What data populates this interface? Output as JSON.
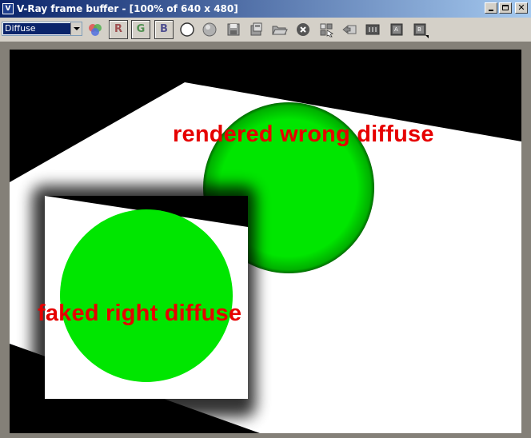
{
  "window": {
    "title": "V-Ray frame buffer - [100% of 640 x 480]",
    "app_icon_letter": "V"
  },
  "toolbar": {
    "channel_dropdown": {
      "selected": "Diffuse"
    },
    "channel_buttons": [
      "R",
      "G",
      "B"
    ],
    "icons": [
      "color-channel-icon",
      "red-channel-button",
      "green-channel-button",
      "blue-channel-button",
      "white-circle-icon",
      "gray-circle-icon",
      "save-icon",
      "clear-icon",
      "open-icon",
      "stop-render-icon",
      "track-mouse-icon",
      "copy-to-history-icon",
      "lens-effects-icon",
      "compare-a-icon",
      "compare-b-icon"
    ]
  },
  "render": {
    "caption_wrong": "rendered wrong diffuse",
    "caption_right": "faked right diffuse"
  },
  "colors": {
    "caption": "#e60000",
    "sphere": "#00e600",
    "floor": "#ffffff",
    "background": "#000000"
  }
}
